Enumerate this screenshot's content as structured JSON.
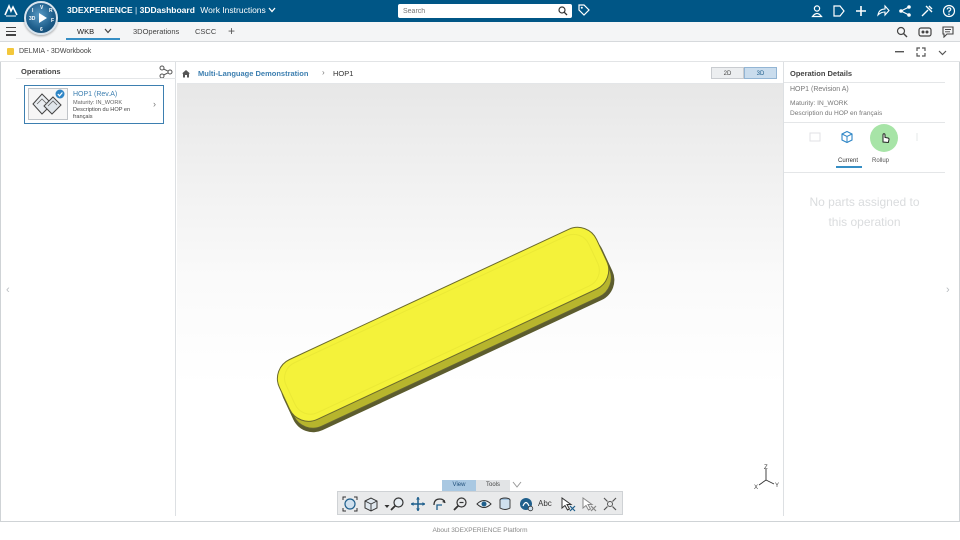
{
  "topbar": {
    "brand_bold": "3DEXPERIENCE",
    "brand_separator": "|",
    "brand_app": "3DDashboard",
    "dashboard_name": "Work Instructions",
    "search_placeholder": "Search",
    "compass_labels": [
      "3D",
      "V",
      "6",
      "R",
      "I",
      "F"
    ],
    "icons": [
      "user-icon",
      "share-tag-icon",
      "add-icon",
      "forward-icon",
      "network-share-icon",
      "tools-icon",
      "help-icon"
    ]
  },
  "tabbar": {
    "tabs": [
      {
        "label": "WKB",
        "active": true
      },
      {
        "label": "3DOperations",
        "active": false
      },
      {
        "label": "CSCC",
        "active": false
      }
    ],
    "add_label": "+"
  },
  "widget": {
    "title": "DELMIA - 3DWorkbook"
  },
  "operations": {
    "title": "Operations",
    "cards": [
      {
        "name": "HOP1 (Rev.A)",
        "maturity": "Maturity: IN_WORK",
        "description": "Description du HOP en français"
      }
    ]
  },
  "breadcrumb": {
    "items": [
      "Multi-Language Demonstration",
      "HOP1"
    ]
  },
  "viewer": {
    "modes": [
      {
        "label": "2D",
        "active": false
      },
      {
        "label": "3D",
        "active": true
      }
    ],
    "part_color": "#f4f23a",
    "view_tabs": [
      {
        "label": "View",
        "active": true
      },
      {
        "label": "Tools",
        "active": false
      }
    ],
    "tools": [
      "fit-all-icon",
      "view-selector-icon",
      "zoom-icon",
      "pan-icon",
      "rotate-icon",
      "zoom-area-icon",
      "look-at-icon",
      "section-icon",
      "measure-icon",
      "annotation-text-icon",
      "select-icon",
      "unselect-icon",
      "explode-icon"
    ],
    "annotation_label": "Abc",
    "axes": {
      "z": "Z",
      "x": "X",
      "y": "Y"
    }
  },
  "details": {
    "title": "Operation Details",
    "revision": "HOP1 (Revision A)",
    "maturity": "Maturity: IN_WORK",
    "description": "Description du HOP en français",
    "tabs": [
      {
        "label": "Current",
        "active": true
      },
      {
        "label": "Rollup",
        "active": false
      }
    ],
    "empty_message_line1": "No parts assigned to",
    "empty_message_line2": "this operation"
  },
  "footer": {
    "link": "About 3DEXPERIENCE Platform"
  },
  "colors": {
    "topbar": "#005686",
    "accent": "#368ec4",
    "link": "#3d7fb0",
    "cursor_halo": "#78d678"
  }
}
